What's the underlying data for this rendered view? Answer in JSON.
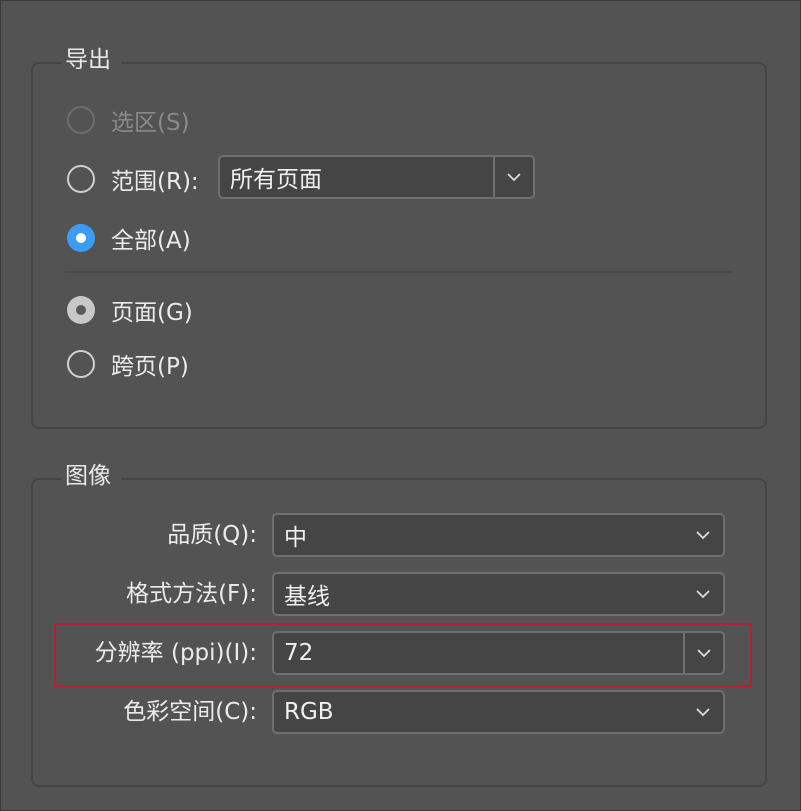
{
  "export_group": {
    "title": "导出",
    "radios": [
      {
        "label": "选区(S)",
        "state": "disabled"
      },
      {
        "label": "范围(R):",
        "state": "unchecked"
      },
      {
        "label": "全部(A)",
        "state": "checked"
      }
    ],
    "range_select": {
      "value": "所有页面"
    },
    "layout_radios": [
      {
        "label": "页面(G)",
        "state": "checked"
      },
      {
        "label": "跨页(P)",
        "state": "unchecked"
      }
    ]
  },
  "image_group": {
    "title": "图像",
    "fields": [
      {
        "label": "品质(Q):",
        "value": "中"
      },
      {
        "label": "格式方法(F):",
        "value": "基线"
      },
      {
        "label": "分辨率 (ppi)(I):",
        "value": "72"
      },
      {
        "label": "色彩空间(C):",
        "value": "RGB"
      }
    ]
  },
  "colors": {
    "background": "#535353",
    "radio_checked": "#3c9cf5",
    "highlight_border": "#b0242f"
  }
}
